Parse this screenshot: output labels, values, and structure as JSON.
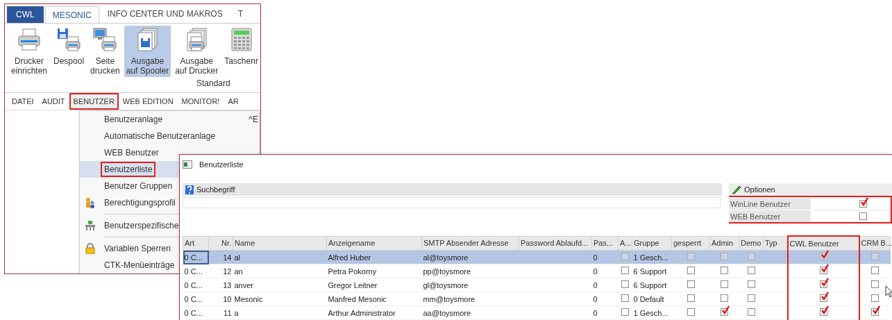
{
  "app_window": {
    "tabs": [
      {
        "label": "CWL",
        "kind": "file",
        "selected": false
      },
      {
        "label": "MESONIC",
        "kind": "tab",
        "selected": true
      },
      {
        "label": "INFO CENTER UND MAKROS",
        "kind": "tab",
        "selected": false
      },
      {
        "label": "T",
        "kind": "tab",
        "selected": false
      }
    ],
    "ribbon": {
      "buttons": [
        {
          "lines": [
            "Drucker",
            "einrichten"
          ],
          "pressed": false
        },
        {
          "lines": [
            "Despool"
          ],
          "pressed": false
        },
        {
          "lines": [
            "Seite",
            "drucken"
          ],
          "pressed": false
        },
        {
          "lines": [
            "Ausgabe",
            "auf Spooler"
          ],
          "pressed": true
        },
        {
          "lines": [
            "Ausgabe",
            "auf Drucker"
          ],
          "pressed": false
        },
        {
          "lines": [
            "Taschenr"
          ],
          "pressed": false
        }
      ],
      "group_label": "Standard"
    },
    "menu_bar": [
      {
        "label": "DATEI",
        "selected": false,
        "highlighted": false
      },
      {
        "label": "AUDIT",
        "selected": false,
        "highlighted": false
      },
      {
        "label": "BENUTZER",
        "selected": true,
        "highlighted": true
      },
      {
        "label": "WEB EDITION",
        "selected": false,
        "highlighted": false
      },
      {
        "label": "MONITOR!",
        "selected": false,
        "highlighted": false
      },
      {
        "label": "AR",
        "selected": false,
        "highlighted": false
      }
    ],
    "dropdown": [
      {
        "kind": "item",
        "label": "Benutzeranlage",
        "shortcut": "^E",
        "selected": false,
        "highlighted": false
      },
      {
        "kind": "item",
        "label": "Automatische Benutzeranlage",
        "selected": false,
        "highlighted": false
      },
      {
        "kind": "item",
        "label": "WEB Benutzer",
        "selected": false,
        "highlighted": false
      },
      {
        "kind": "item",
        "label": "Benutzerliste",
        "selected": true,
        "highlighted": true
      },
      {
        "kind": "item",
        "label": "Benutzer Gruppen",
        "selected": false,
        "highlighted": false
      },
      {
        "kind": "item",
        "label": "Berechtigungsprofil",
        "selected": false,
        "highlighted": false
      },
      {
        "kind": "separator"
      },
      {
        "kind": "item",
        "label": "Benutzerspezifische",
        "selected": false,
        "highlighted": false
      },
      {
        "kind": "separator"
      },
      {
        "kind": "item",
        "label": "Variablen Sperren",
        "selected": false,
        "highlighted": false
      },
      {
        "kind": "item",
        "label": "CTK-Menüeinträge",
        "selected": false,
        "highlighted": false
      }
    ]
  },
  "list_window": {
    "title": "Benutzerliste",
    "search": {
      "label": "Suchbegriff"
    },
    "options": {
      "title": "Optionen",
      "highlighted": true,
      "rows": [
        {
          "label": "WinLine Benutzer",
          "checked": true
        },
        {
          "label": "WEB Benutzer",
          "checked": false
        }
      ]
    },
    "table": {
      "columns": [
        {
          "label": "Art",
          "kind": "text"
        },
        {
          "label": "Nr.",
          "kind": "number"
        },
        {
          "label": "Name",
          "kind": "text"
        },
        {
          "label": "Anzeigename",
          "kind": "text"
        },
        {
          "label": "SMTP Absender Adresse",
          "kind": "text"
        },
        {
          "label": "Password Ablaufd...",
          "kind": "text"
        },
        {
          "label": "Pas...",
          "kind": "text"
        },
        {
          "label": "A...",
          "kind": "check"
        },
        {
          "label": "Gruppe",
          "kind": "text"
        },
        {
          "label": "gesperrt",
          "kind": "check"
        },
        {
          "label": "Admin",
          "kind": "check"
        },
        {
          "label": "Demo",
          "kind": "check"
        },
        {
          "label": "Typ",
          "kind": "text"
        },
        {
          "label": "CWL Benutzer",
          "kind": "check",
          "highlighted": true
        },
        {
          "label": "CRM B...",
          "kind": "check"
        }
      ],
      "rows": [
        {
          "selected": true,
          "cells": [
            "0  C...",
            "14",
            "al",
            "Alfred Huber",
            "al@toysmore",
            null,
            "0",
            false,
            "1  Gesch...",
            false,
            false,
            false,
            null,
            true,
            false
          ]
        },
        {
          "selected": false,
          "cells": [
            "0  C...",
            "12",
            "an",
            "Petra Pokorny",
            "pp@toysmore",
            null,
            "0",
            false,
            "6  Support",
            false,
            false,
            false,
            null,
            true,
            false
          ]
        },
        {
          "selected": false,
          "cells": [
            "0  C...",
            "13",
            "anver",
            "Gregor Leitner",
            "gl@toysmore",
            null,
            "0",
            false,
            "6  Support",
            false,
            false,
            false,
            null,
            true,
            false
          ]
        },
        {
          "selected": false,
          "cells": [
            "0  C...",
            "10",
            "Mesonic",
            "Manfred Mesonic",
            "mm@toysmore",
            null,
            "0",
            false,
            "0  Default",
            false,
            false,
            false,
            null,
            true,
            false
          ]
        },
        {
          "selected": false,
          "cells": [
            "0  C...",
            "11",
            "a",
            "Arthur Administrator",
            "aa@toysmore",
            null,
            "0",
            false,
            "1  Gesch...",
            false,
            true,
            false,
            null,
            true,
            true
          ]
        }
      ]
    }
  }
}
